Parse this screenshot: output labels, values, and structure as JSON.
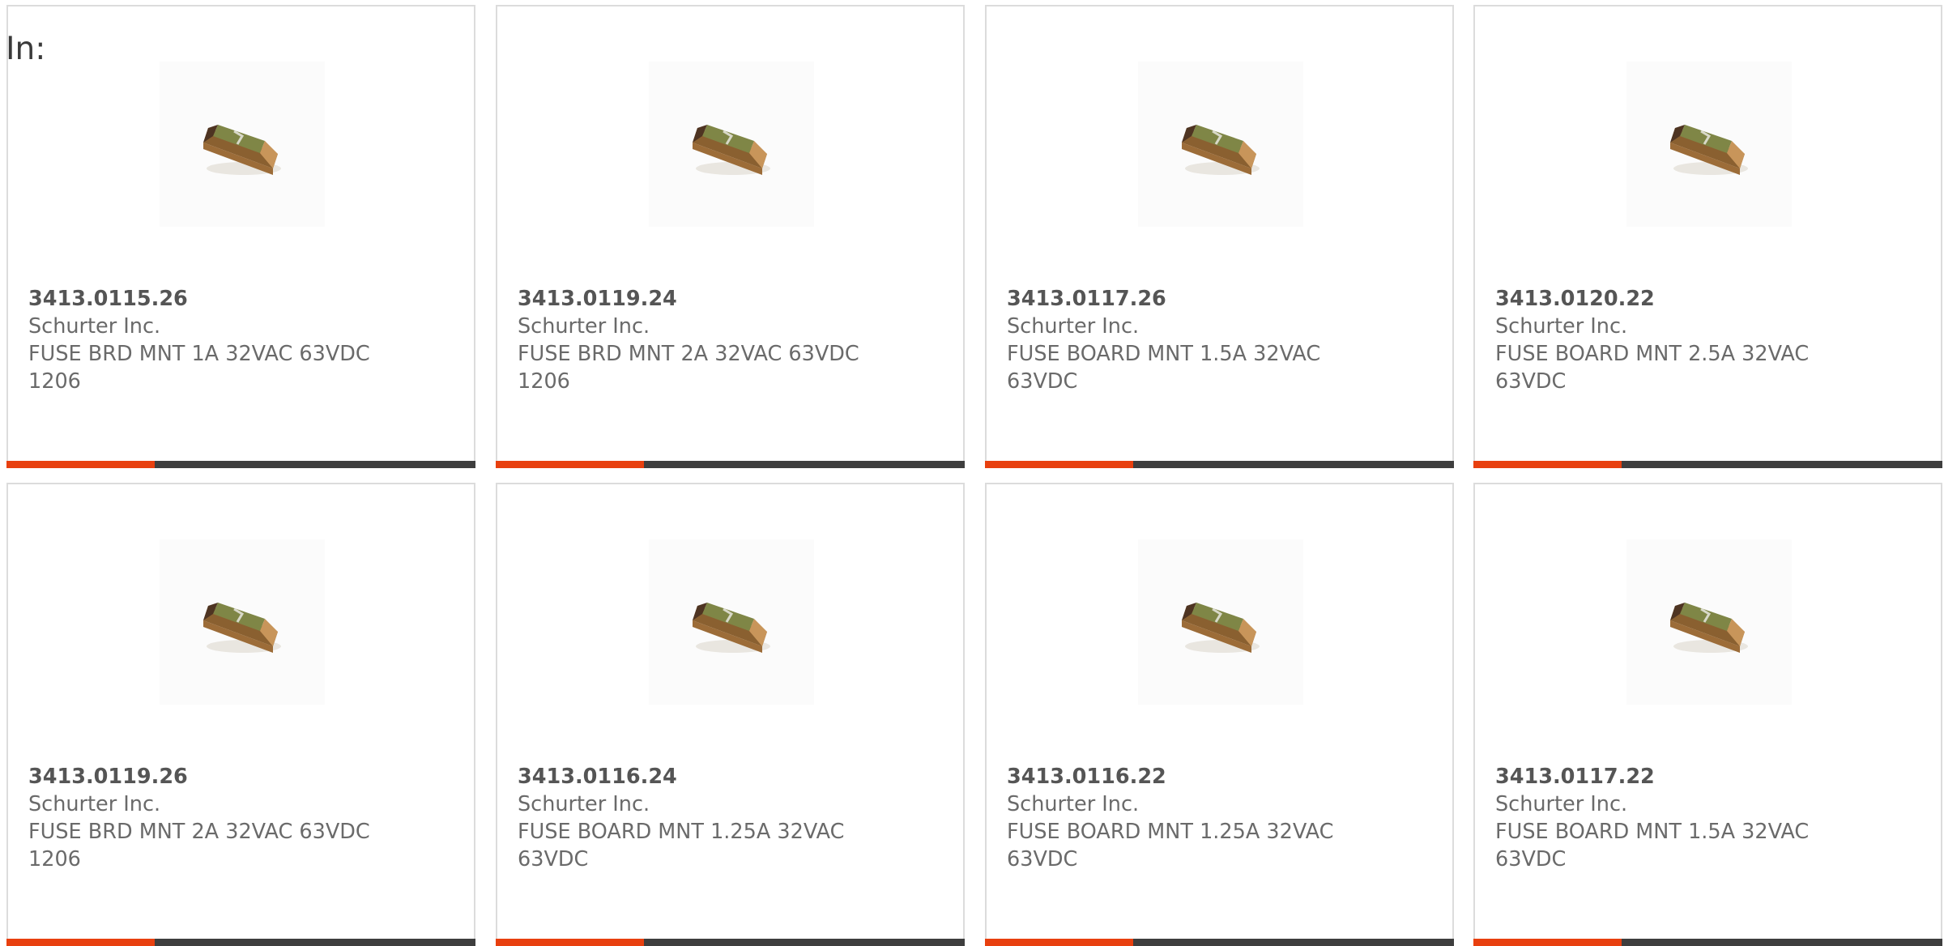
{
  "heading": "In:",
  "colors": {
    "accent": "#e8400f",
    "bar": "#3e3e3e",
    "border": "#dcdcdc",
    "text": "#6a6a6a"
  },
  "products": [
    {
      "part_number": "3413.0115.26",
      "manufacturer": "Schurter Inc.",
      "description": "FUSE BRD MNT 1A 32VAC 63VDC 1206",
      "image_icon": "smd-fuse-image"
    },
    {
      "part_number": "3413.0119.24",
      "manufacturer": "Schurter Inc.",
      "description": "FUSE BRD MNT 2A 32VAC 63VDC 1206",
      "image_icon": "smd-fuse-image"
    },
    {
      "part_number": "3413.0117.26",
      "manufacturer": "Schurter Inc.",
      "description": "FUSE BOARD MNT 1.5A 32VAC 63VDC",
      "image_icon": "smd-fuse-image"
    },
    {
      "part_number": "3413.0120.22",
      "manufacturer": "Schurter Inc.",
      "description": "FUSE BOARD MNT 2.5A 32VAC 63VDC",
      "image_icon": "smd-fuse-image"
    },
    {
      "part_number": "3413.0119.26",
      "manufacturer": "Schurter Inc.",
      "description": "FUSE BRD MNT 2A 32VAC 63VDC 1206",
      "image_icon": "smd-fuse-image"
    },
    {
      "part_number": "3413.0116.24",
      "manufacturer": "Schurter Inc.",
      "description": "FUSE BOARD MNT 1.25A 32VAC 63VDC",
      "image_icon": "smd-fuse-image"
    },
    {
      "part_number": "3413.0116.22",
      "manufacturer": "Schurter Inc.",
      "description": "FUSE BOARD MNT 1.25A 32VAC 63VDC",
      "image_icon": "smd-fuse-image"
    },
    {
      "part_number": "3413.0117.22",
      "manufacturer": "Schurter Inc.",
      "description": "FUSE BOARD MNT 1.5A 32VAC 63VDC",
      "image_icon": "smd-fuse-image"
    }
  ]
}
